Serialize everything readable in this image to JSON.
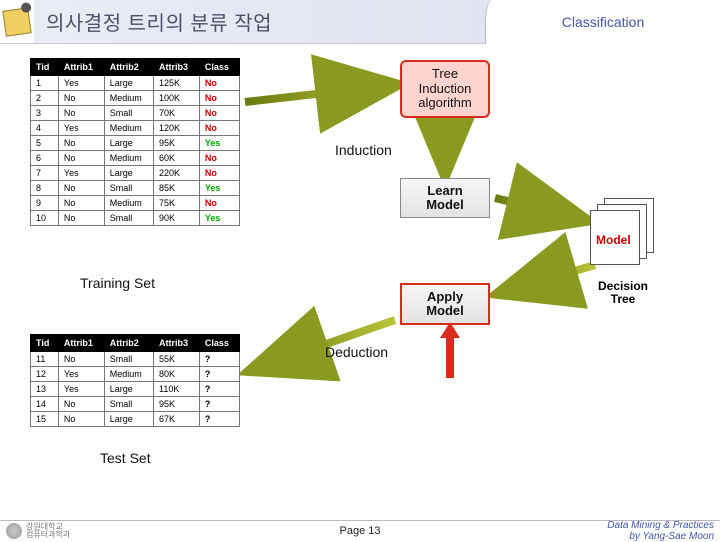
{
  "header": {
    "title": "의사결정 트리의 분류 작업",
    "tab": "Classification"
  },
  "training": {
    "label": "Training Set",
    "cols": [
      "Tid",
      "Attrib1",
      "Attrib2",
      "Attrib3",
      "Class"
    ],
    "rows": [
      [
        "1",
        "Yes",
        "Large",
        "125K",
        "No"
      ],
      [
        "2",
        "No",
        "Medium",
        "100K",
        "No"
      ],
      [
        "3",
        "No",
        "Small",
        "70K",
        "No"
      ],
      [
        "4",
        "Yes",
        "Medium",
        "120K",
        "No"
      ],
      [
        "5",
        "No",
        "Large",
        "95K",
        "Yes"
      ],
      [
        "6",
        "No",
        "Medium",
        "60K",
        "No"
      ],
      [
        "7",
        "Yes",
        "Large",
        "220K",
        "No"
      ],
      [
        "8",
        "No",
        "Small",
        "85K",
        "Yes"
      ],
      [
        "9",
        "No",
        "Medium",
        "75K",
        "No"
      ],
      [
        "10",
        "No",
        "Small",
        "90K",
        "Yes"
      ]
    ]
  },
  "test": {
    "label": "Test Set",
    "cols": [
      "Tid",
      "Attrib1",
      "Attrib2",
      "Attrib3",
      "Class"
    ],
    "rows": [
      [
        "11",
        "No",
        "Small",
        "55K",
        "?"
      ],
      [
        "12",
        "Yes",
        "Medium",
        "80K",
        "?"
      ],
      [
        "13",
        "Yes",
        "Large",
        "110K",
        "?"
      ],
      [
        "14",
        "No",
        "Small",
        "95K",
        "?"
      ],
      [
        "15",
        "No",
        "Large",
        "67K",
        "?"
      ]
    ]
  },
  "boxes": {
    "algo_l1": "Tree",
    "algo_l2": "Induction",
    "algo_l3": "algorithm",
    "learn_l1": "Learn",
    "learn_l2": "Model",
    "apply_l1": "Apply",
    "apply_l2": "Model",
    "model": "Model",
    "dtree_l1": "Decision",
    "dtree_l2": "Tree"
  },
  "labels": {
    "induction": "Induction",
    "deduction": "Deduction"
  },
  "footer": {
    "inst_l1": "강원대학교",
    "inst_l2": "컴퓨터과학과",
    "page": "Page 13",
    "r1": "Data Mining & Practices",
    "r2": "by Yang-Sae Moon"
  }
}
